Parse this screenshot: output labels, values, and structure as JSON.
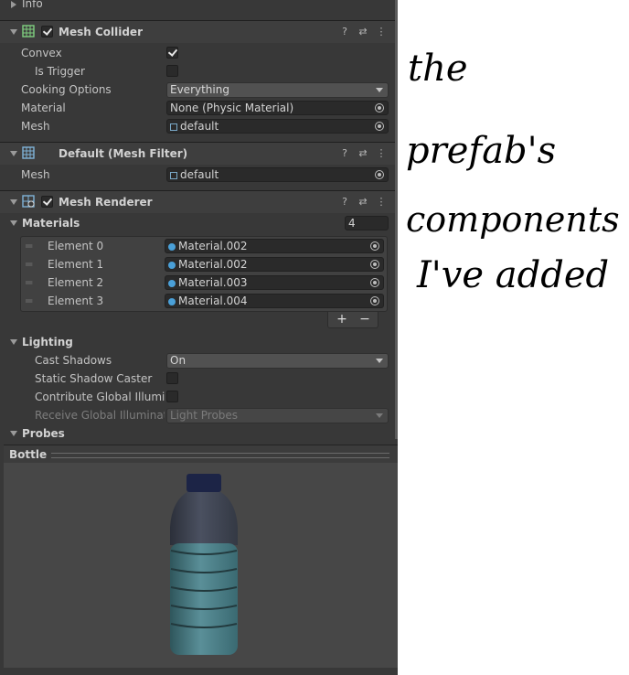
{
  "info": {
    "label": "Info"
  },
  "mesh_collider": {
    "title": "Mesh Collider",
    "enabled": true,
    "convex": {
      "label": "Convex",
      "checked": true
    },
    "is_trigger": {
      "label": "Is Trigger",
      "checked": false
    },
    "cooking_options": {
      "label": "Cooking Options",
      "value": "Everything"
    },
    "material": {
      "label": "Material",
      "value": "None (Physic Material)"
    },
    "mesh": {
      "label": "Mesh",
      "value": "default"
    }
  },
  "mesh_filter": {
    "title": "Default (Mesh Filter)",
    "mesh": {
      "label": "Mesh",
      "value": "default"
    }
  },
  "mesh_renderer": {
    "title": "Mesh Renderer",
    "enabled": true,
    "materials": {
      "label": "Materials",
      "size": "4",
      "elements": [
        {
          "label": "Element 0",
          "value": "Material.002"
        },
        {
          "label": "Element 1",
          "value": "Material.002"
        },
        {
          "label": "Element 2",
          "value": "Material.003"
        },
        {
          "label": "Element 3",
          "value": "Material.004"
        }
      ],
      "add": "+",
      "remove": "−"
    },
    "lighting": {
      "label": "Lighting",
      "cast_shadows": {
        "label": "Cast Shadows",
        "value": "On"
      },
      "static_shadow_caster": {
        "label": "Static Shadow Caster",
        "checked": false
      },
      "contribute_gi": {
        "label": "Contribute Global Illumina",
        "checked": false
      },
      "receive_gi": {
        "label": "Receive Global Illuminatic",
        "value": "Light Probes"
      }
    },
    "probes": {
      "label": "Probes"
    }
  },
  "preview": {
    "title": "Bottle"
  },
  "annotation": {
    "line1": "the",
    "line2": "prefab's",
    "line3": "components",
    "line4": "I've added"
  },
  "colors": {
    "panel_bg": "#383838",
    "header_bg": "#3e3e3e",
    "field_bg": "#2a2a2a",
    "text": "#c4c4c4",
    "bottle_body": "#4f7f88",
    "bottle_top": "#3b4150",
    "bottle_cap": "#1c2446"
  },
  "icons": [
    "help-icon",
    "presets-icon",
    "kebab-menu-icon",
    "mesh-collider-icon",
    "mesh-filter-icon",
    "mesh-renderer-icon",
    "object-picker-icon",
    "drag-handle-icon"
  ]
}
